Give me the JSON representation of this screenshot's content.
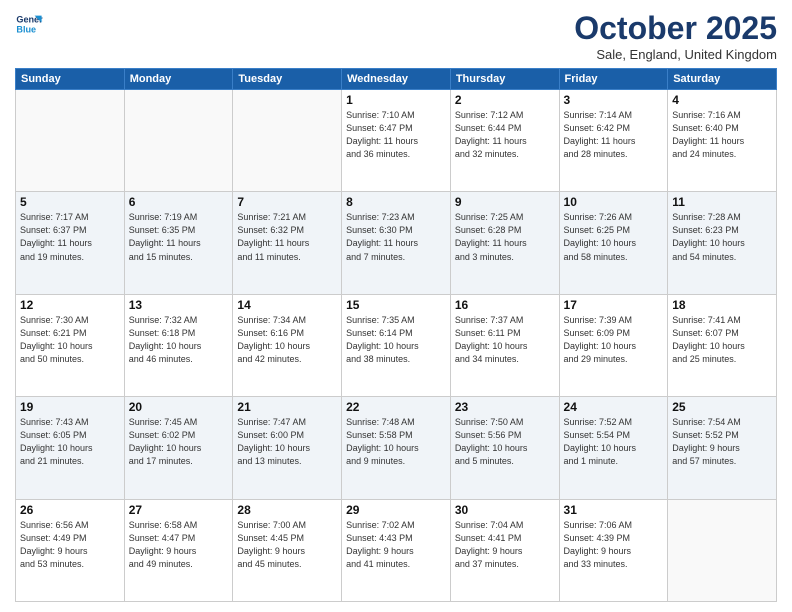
{
  "logo": {
    "line1": "General",
    "line2": "Blue"
  },
  "header": {
    "month": "October 2025",
    "location": "Sale, England, United Kingdom"
  },
  "weekdays": [
    "Sunday",
    "Monday",
    "Tuesday",
    "Wednesday",
    "Thursday",
    "Friday",
    "Saturday"
  ],
  "weeks": [
    [
      {
        "day": "",
        "info": ""
      },
      {
        "day": "",
        "info": ""
      },
      {
        "day": "",
        "info": ""
      },
      {
        "day": "1",
        "info": "Sunrise: 7:10 AM\nSunset: 6:47 PM\nDaylight: 11 hours\nand 36 minutes."
      },
      {
        "day": "2",
        "info": "Sunrise: 7:12 AM\nSunset: 6:44 PM\nDaylight: 11 hours\nand 32 minutes."
      },
      {
        "day": "3",
        "info": "Sunrise: 7:14 AM\nSunset: 6:42 PM\nDaylight: 11 hours\nand 28 minutes."
      },
      {
        "day": "4",
        "info": "Sunrise: 7:16 AM\nSunset: 6:40 PM\nDaylight: 11 hours\nand 24 minutes."
      }
    ],
    [
      {
        "day": "5",
        "info": "Sunrise: 7:17 AM\nSunset: 6:37 PM\nDaylight: 11 hours\nand 19 minutes."
      },
      {
        "day": "6",
        "info": "Sunrise: 7:19 AM\nSunset: 6:35 PM\nDaylight: 11 hours\nand 15 minutes."
      },
      {
        "day": "7",
        "info": "Sunrise: 7:21 AM\nSunset: 6:32 PM\nDaylight: 11 hours\nand 11 minutes."
      },
      {
        "day": "8",
        "info": "Sunrise: 7:23 AM\nSunset: 6:30 PM\nDaylight: 11 hours\nand 7 minutes."
      },
      {
        "day": "9",
        "info": "Sunrise: 7:25 AM\nSunset: 6:28 PM\nDaylight: 11 hours\nand 3 minutes."
      },
      {
        "day": "10",
        "info": "Sunrise: 7:26 AM\nSunset: 6:25 PM\nDaylight: 10 hours\nand 58 minutes."
      },
      {
        "day": "11",
        "info": "Sunrise: 7:28 AM\nSunset: 6:23 PM\nDaylight: 10 hours\nand 54 minutes."
      }
    ],
    [
      {
        "day": "12",
        "info": "Sunrise: 7:30 AM\nSunset: 6:21 PM\nDaylight: 10 hours\nand 50 minutes."
      },
      {
        "day": "13",
        "info": "Sunrise: 7:32 AM\nSunset: 6:18 PM\nDaylight: 10 hours\nand 46 minutes."
      },
      {
        "day": "14",
        "info": "Sunrise: 7:34 AM\nSunset: 6:16 PM\nDaylight: 10 hours\nand 42 minutes."
      },
      {
        "day": "15",
        "info": "Sunrise: 7:35 AM\nSunset: 6:14 PM\nDaylight: 10 hours\nand 38 minutes."
      },
      {
        "day": "16",
        "info": "Sunrise: 7:37 AM\nSunset: 6:11 PM\nDaylight: 10 hours\nand 34 minutes."
      },
      {
        "day": "17",
        "info": "Sunrise: 7:39 AM\nSunset: 6:09 PM\nDaylight: 10 hours\nand 29 minutes."
      },
      {
        "day": "18",
        "info": "Sunrise: 7:41 AM\nSunset: 6:07 PM\nDaylight: 10 hours\nand 25 minutes."
      }
    ],
    [
      {
        "day": "19",
        "info": "Sunrise: 7:43 AM\nSunset: 6:05 PM\nDaylight: 10 hours\nand 21 minutes."
      },
      {
        "day": "20",
        "info": "Sunrise: 7:45 AM\nSunset: 6:02 PM\nDaylight: 10 hours\nand 17 minutes."
      },
      {
        "day": "21",
        "info": "Sunrise: 7:47 AM\nSunset: 6:00 PM\nDaylight: 10 hours\nand 13 minutes."
      },
      {
        "day": "22",
        "info": "Sunrise: 7:48 AM\nSunset: 5:58 PM\nDaylight: 10 hours\nand 9 minutes."
      },
      {
        "day": "23",
        "info": "Sunrise: 7:50 AM\nSunset: 5:56 PM\nDaylight: 10 hours\nand 5 minutes."
      },
      {
        "day": "24",
        "info": "Sunrise: 7:52 AM\nSunset: 5:54 PM\nDaylight: 10 hours\nand 1 minute."
      },
      {
        "day": "25",
        "info": "Sunrise: 7:54 AM\nSunset: 5:52 PM\nDaylight: 9 hours\nand 57 minutes."
      }
    ],
    [
      {
        "day": "26",
        "info": "Sunrise: 6:56 AM\nSunset: 4:49 PM\nDaylight: 9 hours\nand 53 minutes."
      },
      {
        "day": "27",
        "info": "Sunrise: 6:58 AM\nSunset: 4:47 PM\nDaylight: 9 hours\nand 49 minutes."
      },
      {
        "day": "28",
        "info": "Sunrise: 7:00 AM\nSunset: 4:45 PM\nDaylight: 9 hours\nand 45 minutes."
      },
      {
        "day": "29",
        "info": "Sunrise: 7:02 AM\nSunset: 4:43 PM\nDaylight: 9 hours\nand 41 minutes."
      },
      {
        "day": "30",
        "info": "Sunrise: 7:04 AM\nSunset: 4:41 PM\nDaylight: 9 hours\nand 37 minutes."
      },
      {
        "day": "31",
        "info": "Sunrise: 7:06 AM\nSunset: 4:39 PM\nDaylight: 9 hours\nand 33 minutes."
      },
      {
        "day": "",
        "info": ""
      }
    ]
  ]
}
